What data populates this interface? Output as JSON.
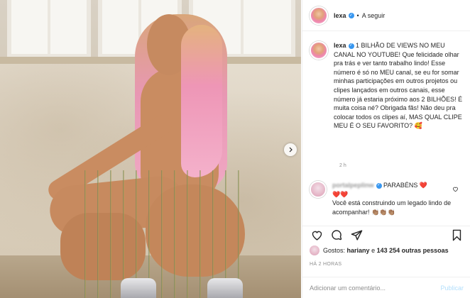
{
  "header": {
    "username": "lexa",
    "separator": "•",
    "follow_label": "A seguir"
  },
  "caption": {
    "username": "lexa",
    "text": "1 BILHÃO DE VIEWS NO MEU CANAL NO YOUTUBE! Que felicidade olhar pra trás e ver tanto trabalho lindo! Esse número é só no MEU canal, se eu for somar minhas participações em outros projetos ou clipes lançados em outros canais, esse número já estaria próximo aos 2 BILHÕES! É muita coisa né? Obrigada fãs! Não deu pra colocar todos os clipes aí, MAS QUAL CLIPE MEU É O SEU FAVORITO? 🥰",
    "time": "2 h"
  },
  "comment": {
    "username": "portalpeplinw",
    "text_line1": "PARABÉNS ❤️",
    "text_line2": "❤️❤️",
    "text_line3": "Você está construindo um legado lindo de acompanhar! 👏🏽👏🏽👏🏽"
  },
  "likes": {
    "prefix": "Gostos:",
    "first_user": "hariany",
    "connector": "e",
    "others": "143 254 outras pessoas"
  },
  "posted": "HÁ 2 HORAS",
  "comment_box": {
    "placeholder": "Adicionar um comentário...",
    "publish_label": "Publicar"
  },
  "icons": {
    "verified": "verified-badge-icon",
    "next": "chevron-right-icon",
    "like": "heart-icon",
    "comment": "comment-icon",
    "share": "share-icon",
    "save": "bookmark-icon"
  },
  "colors": {
    "verified": "#3897f0",
    "publish": "#b2dffc",
    "muted": "#8e8e8e",
    "text": "#262626"
  }
}
